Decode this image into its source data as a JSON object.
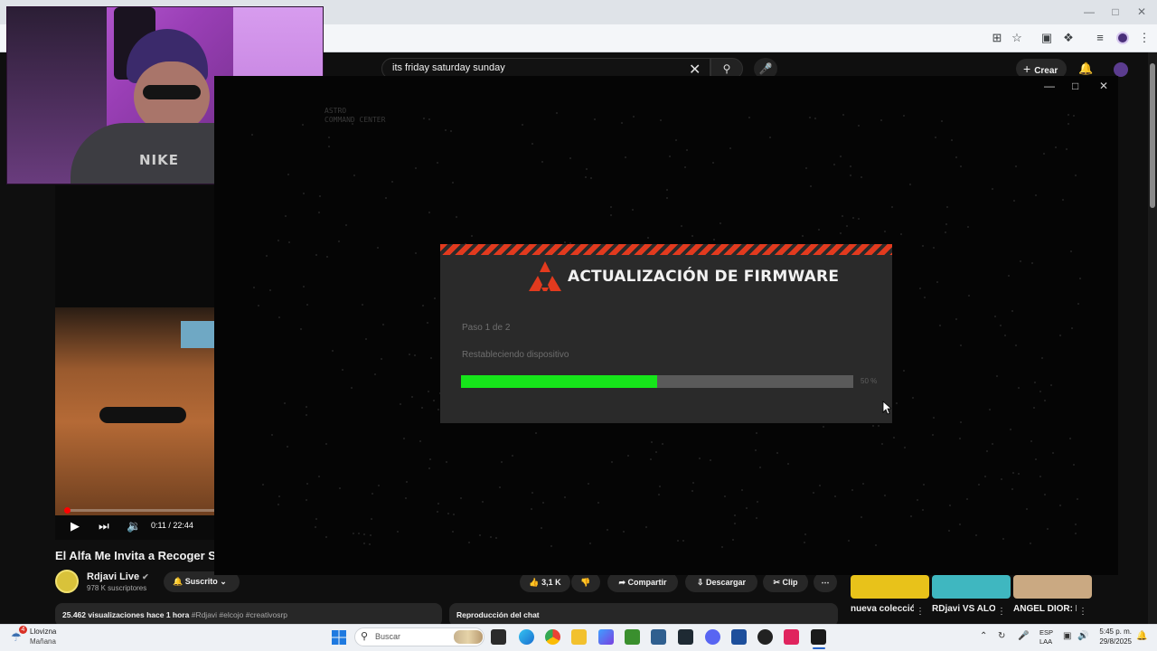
{
  "browser": {
    "toolbar_icons": [
      "install-icon",
      "star-icon",
      "extension-icon",
      "puzzle-icon",
      "media-icon",
      "profile-icon",
      "more-icon"
    ]
  },
  "youtube": {
    "search": {
      "query": "its friday saturday sunday"
    },
    "create_label": "Crear",
    "player": {
      "time": "0:11 / 22:44",
      "progress_fraction": 0.008
    },
    "video": {
      "title": "El Alfa Me Invita a Recoger Su",
      "channel": "Rdjavi Live",
      "subscribers": "978 K suscriptores",
      "subscribed_label": "Suscrito",
      "likes": "3,1 K",
      "share_label": "Compartir",
      "download_label": "Descargar",
      "clip_label": "Clip",
      "views_line": "25.462 visualizaciones  hace 1 hora",
      "tags": "#Rdjavi #elcojo #creativosrp",
      "chat_label": "Reproducción del chat"
    },
    "shorts": [
      {
        "title": "nueva colección d",
        "color": "#e8c21a"
      },
      {
        "title": "RDjavi VS ALOFOKE",
        "color": "#3fb7c0"
      },
      {
        "title": "ANGEL DIOR: El Alfa me",
        "color": "#caa982"
      }
    ]
  },
  "app": {
    "brand_line1": "ASTRO",
    "brand_line2": "COMMAND CENTER",
    "modal": {
      "title": "ACTUALIZACIÓN DE FIRMWARE",
      "step": "Paso 1 de 2",
      "status": "Restableciendo dispositivo",
      "progress_percent": 50,
      "progress_label": "50 %",
      "accent": "#e23a1e",
      "bar_color": "#16e51a"
    }
  },
  "taskbar": {
    "weather_title": "Llovizna",
    "weather_sub": "Mañana",
    "weather_badge": "4",
    "search_placeholder": "Buscar",
    "lang1": "ESP",
    "lang2": "LAA",
    "time": "5:45 p. m.",
    "date": "29/8/2025"
  }
}
